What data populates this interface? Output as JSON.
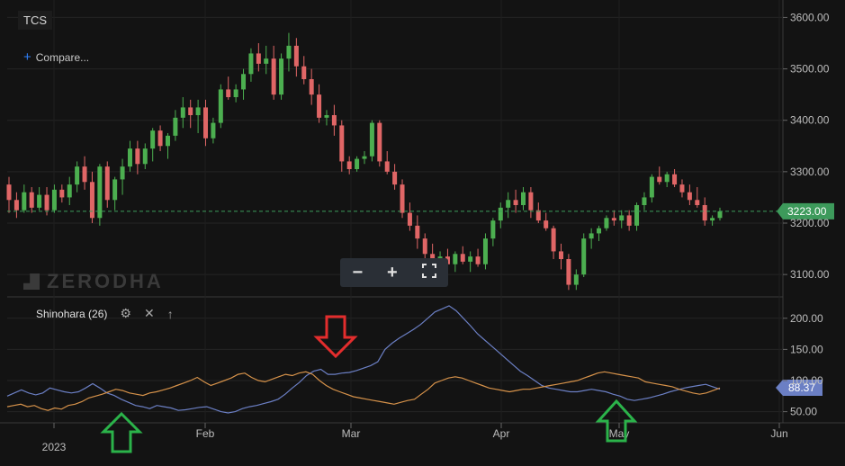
{
  "header": {
    "symbol": "TCS",
    "compare_label": "Compare...",
    "compare_icon": "plus-icon"
  },
  "watermark": {
    "text": "ZERODHA"
  },
  "toolbar": {
    "zoom_out_icon": "minus-icon",
    "zoom_in_icon": "plus-icon",
    "fullscreen_icon": "fullscreen-icon"
  },
  "indicator": {
    "name": "Shinohara (26)",
    "settings_icon": "gear-icon",
    "remove_icon": "close-icon",
    "move_icon": "arrow-up-icon"
  },
  "colors": {
    "background": "#131313",
    "up": "#4caf50",
    "down": "#e06666",
    "price_badge": "#3d9a5b",
    "line_blue": "#6b7fc4",
    "line_orange": "#d6924a",
    "arrow_red": "#e32d2d",
    "arrow_green": "#2bb34a"
  },
  "chart_data": [
    {
      "type": "candlestick",
      "title": "TCS",
      "y_ticks": [
        "3600.00",
        "3500.00",
        "3400.00",
        "3300.00",
        "3200.00",
        "3100.00"
      ],
      "ylim": [
        3060,
        3620
      ],
      "last_price": 3223,
      "last_price_label": "3223.00",
      "x_ticks": [
        "2023",
        "Feb",
        "Mar",
        "Apr",
        "May",
        "Jun"
      ],
      "grid": true,
      "candles": [
        [
          3275,
          3290,
          3220,
          3245
        ],
        [
          3245,
          3260,
          3210,
          3225
        ],
        [
          3225,
          3275,
          3220,
          3260
        ],
        [
          3260,
          3270,
          3220,
          3230
        ],
        [
          3230,
          3270,
          3225,
          3255
        ],
        [
          3255,
          3270,
          3215,
          3225
        ],
        [
          3225,
          3275,
          3220,
          3265
        ],
        [
          3265,
          3275,
          3240,
          3250
        ],
        [
          3250,
          3290,
          3235,
          3275
        ],
        [
          3275,
          3320,
          3260,
          3310
        ],
        [
          3310,
          3330,
          3265,
          3280
        ],
        [
          3280,
          3300,
          3200,
          3210
        ],
        [
          3210,
          3315,
          3195,
          3310
        ],
        [
          3310,
          3320,
          3230,
          3245
        ],
        [
          3245,
          3290,
          3225,
          3285
        ],
        [
          3285,
          3325,
          3255,
          3310
        ],
        [
          3310,
          3360,
          3300,
          3345
        ],
        [
          3345,
          3360,
          3295,
          3315
        ],
        [
          3315,
          3355,
          3305,
          3345
        ],
        [
          3345,
          3385,
          3320,
          3380
        ],
        [
          3380,
          3390,
          3340,
          3350
        ],
        [
          3350,
          3375,
          3325,
          3370
        ],
        [
          3370,
          3420,
          3360,
          3405
        ],
        [
          3405,
          3445,
          3385,
          3425
        ],
        [
          3425,
          3440,
          3385,
          3410
        ],
        [
          3410,
          3440,
          3375,
          3425
        ],
        [
          3425,
          3440,
          3350,
          3365
        ],
        [
          3365,
          3405,
          3355,
          3395
        ],
        [
          3395,
          3470,
          3385,
          3460
        ],
        [
          3460,
          3485,
          3440,
          3445
        ],
        [
          3445,
          3470,
          3435,
          3460
        ],
        [
          3460,
          3500,
          3440,
          3490
        ],
        [
          3490,
          3540,
          3475,
          3530
        ],
        [
          3530,
          3550,
          3495,
          3510
        ],
        [
          3510,
          3545,
          3490,
          3520
        ],
        [
          3520,
          3545,
          3440,
          3450
        ],
        [
          3450,
          3530,
          3440,
          3520
        ],
        [
          3520,
          3570,
          3495,
          3545
        ],
        [
          3545,
          3560,
          3485,
          3505
        ],
        [
          3505,
          3525,
          3470,
          3480
        ],
        [
          3480,
          3500,
          3430,
          3450
        ],
        [
          3450,
          3470,
          3395,
          3405
        ],
        [
          3405,
          3420,
          3390,
          3410
        ],
        [
          3410,
          3430,
          3370,
          3390
        ],
        [
          3390,
          3400,
          3300,
          3320
        ],
        [
          3320,
          3330,
          3295,
          3305
        ],
        [
          3305,
          3330,
          3300,
          3325
        ],
        [
          3325,
          3340,
          3315,
          3330
        ],
        [
          3330,
          3400,
          3320,
          3395
        ],
        [
          3395,
          3400,
          3310,
          3320
        ],
        [
          3320,
          3340,
          3295,
          3300
        ],
        [
          3300,
          3315,
          3265,
          3275
        ],
        [
          3275,
          3285,
          3210,
          3220
        ],
        [
          3220,
          3240,
          3185,
          3195
        ],
        [
          3195,
          3215,
          3150,
          3170
        ],
        [
          3170,
          3180,
          3120,
          3140
        ],
        [
          3140,
          3160,
          3100,
          3115
        ],
        [
          3115,
          3145,
          3100,
          3135
        ],
        [
          3135,
          3150,
          3105,
          3120
        ],
        [
          3120,
          3145,
          3105,
          3140
        ],
        [
          3140,
          3155,
          3120,
          3125
        ],
        [
          3125,
          3145,
          3105,
          3135
        ],
        [
          3135,
          3150,
          3115,
          3120
        ],
        [
          3120,
          3180,
          3110,
          3170
        ],
        [
          3170,
          3210,
          3155,
          3205
        ],
        [
          3205,
          3240,
          3190,
          3230
        ],
        [
          3230,
          3260,
          3210,
          3245
        ],
        [
          3245,
          3265,
          3220,
          3235
        ],
        [
          3235,
          3270,
          3225,
          3260
        ],
        [
          3260,
          3270,
          3210,
          3225
        ],
        [
          3225,
          3240,
          3200,
          3205
        ],
        [
          3205,
          3220,
          3185,
          3190
        ],
        [
          3190,
          3195,
          3130,
          3145
        ],
        [
          3145,
          3160,
          3110,
          3130
        ],
        [
          3130,
          3140,
          3070,
          3080
        ],
        [
          3080,
          3110,
          3070,
          3100
        ],
        [
          3100,
          3180,
          3095,
          3170
        ],
        [
          3170,
          3190,
          3150,
          3180
        ],
        [
          3180,
          3195,
          3165,
          3190
        ],
        [
          3190,
          3215,
          3185,
          3210
        ],
        [
          3210,
          3225,
          3195,
          3205
        ],
        [
          3205,
          3225,
          3190,
          3215
        ],
        [
          3215,
          3225,
          3185,
          3195
        ],
        [
          3195,
          3240,
          3185,
          3235
        ],
        [
          3235,
          3260,
          3225,
          3250
        ],
        [
          3250,
          3295,
          3240,
          3290
        ],
        [
          3290,
          3310,
          3275,
          3280
        ],
        [
          3280,
          3300,
          3270,
          3295
        ],
        [
          3295,
          3305,
          3270,
          3275
        ],
        [
          3275,
          3285,
          3250,
          3260
        ],
        [
          3260,
          3275,
          3235,
          3245
        ],
        [
          3245,
          3270,
          3230,
          3235
        ],
        [
          3235,
          3250,
          3195,
          3205
        ],
        [
          3205,
          3215,
          3195,
          3210
        ],
        [
          3210,
          3230,
          3205,
          3223
        ]
      ]
    },
    {
      "type": "line",
      "title": "Shinohara (26)",
      "y_ticks": [
        "200.00",
        "150.00",
        "100.00",
        "50.00"
      ],
      "ylim": [
        35,
        230
      ],
      "last_value_label": "88.37",
      "series": [
        {
          "values": [
            75,
            80,
            85,
            80,
            77,
            80,
            88,
            85,
            82,
            80,
            82,
            88,
            95,
            88,
            80,
            76,
            70,
            65,
            60,
            58,
            55,
            60,
            58,
            56,
            52,
            53,
            55,
            57,
            58,
            54,
            50,
            48,
            50,
            55,
            58,
            60,
            63,
            66,
            70,
            78,
            88,
            97,
            108,
            115,
            118,
            110,
            110,
            112,
            113,
            116,
            120,
            124,
            130,
            150,
            160,
            168,
            175,
            182,
            190,
            200,
            210,
            215,
            220,
            212,
            200,
            188,
            175,
            165,
            155,
            145,
            135,
            125,
            115,
            108,
            100,
            92,
            88,
            86,
            84,
            82,
            82,
            84,
            86,
            84,
            82,
            78,
            75,
            70,
            68,
            70,
            72,
            75,
            78,
            82,
            85,
            88,
            90,
            92,
            94,
            90,
            86
          ]
        },
        {
          "values": [
            58,
            60,
            62,
            58,
            60,
            55,
            52,
            56,
            54,
            60,
            62,
            66,
            72,
            75,
            78,
            82,
            86,
            84,
            80,
            78,
            76,
            80,
            82,
            85,
            88,
            92,
            96,
            100,
            105,
            98,
            92,
            96,
            100,
            104,
            110,
            112,
            105,
            100,
            98,
            102,
            106,
            110,
            108,
            112,
            114,
            110,
            100,
            92,
            86,
            82,
            78,
            74,
            72,
            70,
            68,
            66,
            64,
            62,
            65,
            68,
            70,
            78,
            86,
            96,
            100,
            104,
            106,
            104,
            100,
            96,
            92,
            88,
            86,
            84,
            82,
            84,
            86,
            86,
            88,
            90,
            92,
            94,
            96,
            98,
            100,
            104,
            108,
            112,
            114,
            112,
            110,
            108,
            106,
            104,
            98,
            96,
            94,
            92,
            90,
            86,
            83,
            80,
            78,
            80,
            84,
            88
          ]
        }
      ]
    }
  ]
}
